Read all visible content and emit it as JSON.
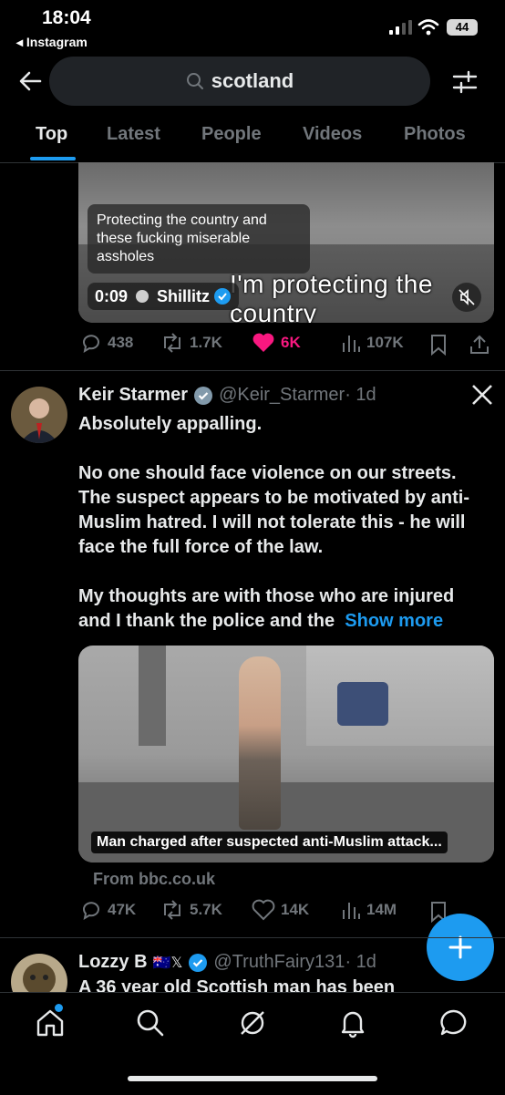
{
  "status_bar": {
    "time": "18:04",
    "back_app": "◂ Instagram",
    "battery": "44"
  },
  "search": {
    "query": "scotland"
  },
  "tabs": [
    {
      "label": "Top",
      "active": true
    },
    {
      "label": "Latest",
      "active": false
    },
    {
      "label": "Videos",
      "active": false
    },
    {
      "label": "People",
      "active": false
    },
    {
      "label": "Photos",
      "active": false
    }
  ],
  "post1": {
    "caption": "Protecting the country and these fucking miserable assholes",
    "subtitle": "I'm protecting the country",
    "duration": "0:09",
    "author": "Shillitz",
    "replies": "438",
    "reposts": "1.7K",
    "likes": "6K",
    "views": "107K",
    "like_color": "#f91880"
  },
  "post2": {
    "name": "Keir Starmer",
    "handle": "@Keir_Starmer",
    "age": "· 1d",
    "line1": "Absolutely appalling.",
    "para2": "No one should face violence on our streets. The suspect appears to be motivated by anti-Muslim hatred. I will not tolerate this - he will face the full force of the law.",
    "para3": "My thoughts are with those who are injured and I thank the police and the",
    "show_more": "Show more",
    "card_title": "Man charged after suspected anti-Muslim attack...",
    "card_source": "From bbc.co.uk",
    "replies": "47K",
    "reposts": "5.7K",
    "likes": "14K",
    "views": "14M"
  },
  "post3": {
    "name": "Lozzy B",
    "flags": "🇦🇺𝕏",
    "handle": "@TruthFairy131",
    "age": "· 1d",
    "text": "A 36 year old Scottish man has been"
  },
  "colors": {
    "accent": "#1d9bf0",
    "muted": "#71767b",
    "text": "#e7e9ea",
    "background": "#000000"
  }
}
